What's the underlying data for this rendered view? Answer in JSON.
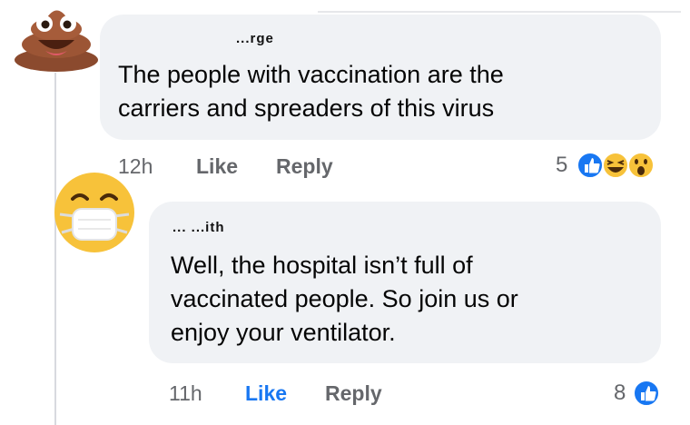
{
  "comments": [
    {
      "author": "...rge",
      "text_lines": [
        "The people with vaccination are the",
        "carriers and spreaders of this virus"
      ],
      "time": "12h",
      "like_label": "Like",
      "reply_label": "Reply",
      "reaction_count": "5",
      "avatar_icon": "poop-emoji-icon",
      "reaction_icons": [
        "like-reaction-icon",
        "haha-reaction-icon",
        "wow-reaction-icon"
      ]
    },
    {
      "author": "... ...ith",
      "text_lines": [
        "Well, the hospital isn’t full of",
        "vaccinated people. So join us or",
        "enjoy your ventilator."
      ],
      "time": "11h",
      "like_label": "Like",
      "reply_label": "Reply",
      "reaction_count": "8",
      "avatar_icon": "medical-mask-emoji-icon",
      "reaction_icons": [
        "like-reaction-icon"
      ]
    }
  ],
  "colors": {
    "bubble": "#f0f2f5",
    "muted_text": "#65676b",
    "like_blue": "#1877f2"
  }
}
